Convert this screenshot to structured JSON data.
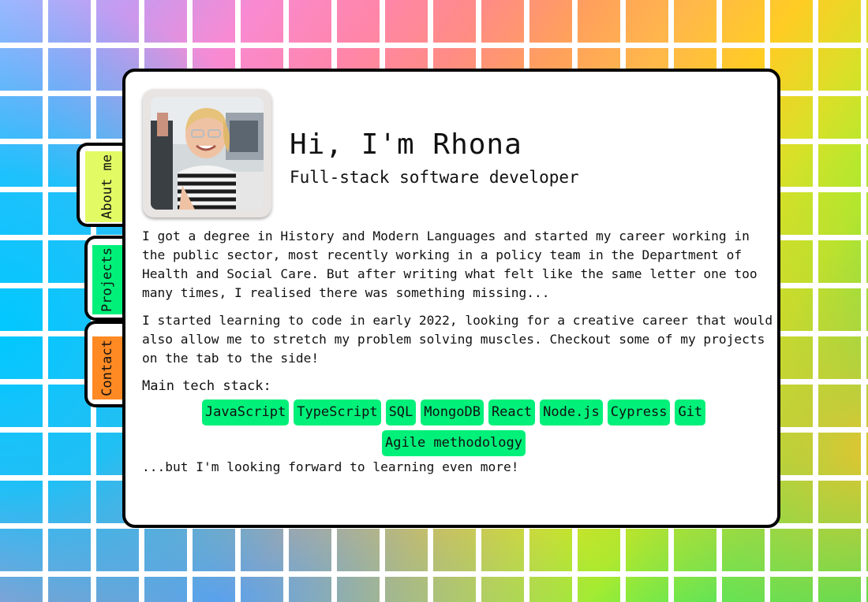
{
  "profile": {
    "title": "Hi, I'm Rhona",
    "subtitle": "Full-stack software developer"
  },
  "tabs": {
    "about": "About me",
    "projects": "Projects",
    "contact": "Contact"
  },
  "about": {
    "paragraph1": "I got a degree in History and Modern Languages and started my career working in the public sector, most recently working in a policy team in the Department of Health and Social Care. But after writing what felt like the same letter one too many times, I realised there was something missing...",
    "paragraph2": "I started learning to code in early 2022, looking for a creative career that would also allow me to stretch my problem solving muscles. Checkout some of my projects on the tab to the side!",
    "stack_label": "Main tech stack:",
    "stack": [
      "JavaScript",
      "TypeScript",
      "SQL",
      "MongoDB",
      "React",
      "Node.js",
      "Cypress",
      "Git",
      "Agile methodology"
    ],
    "outro": "...but I'm looking forward to learning even more!"
  },
  "colors": {
    "tab_about": "#e2fa64",
    "tab_projects": "#00f07a",
    "tab_contact": "#ff8a24",
    "tag": "#00f07a"
  }
}
